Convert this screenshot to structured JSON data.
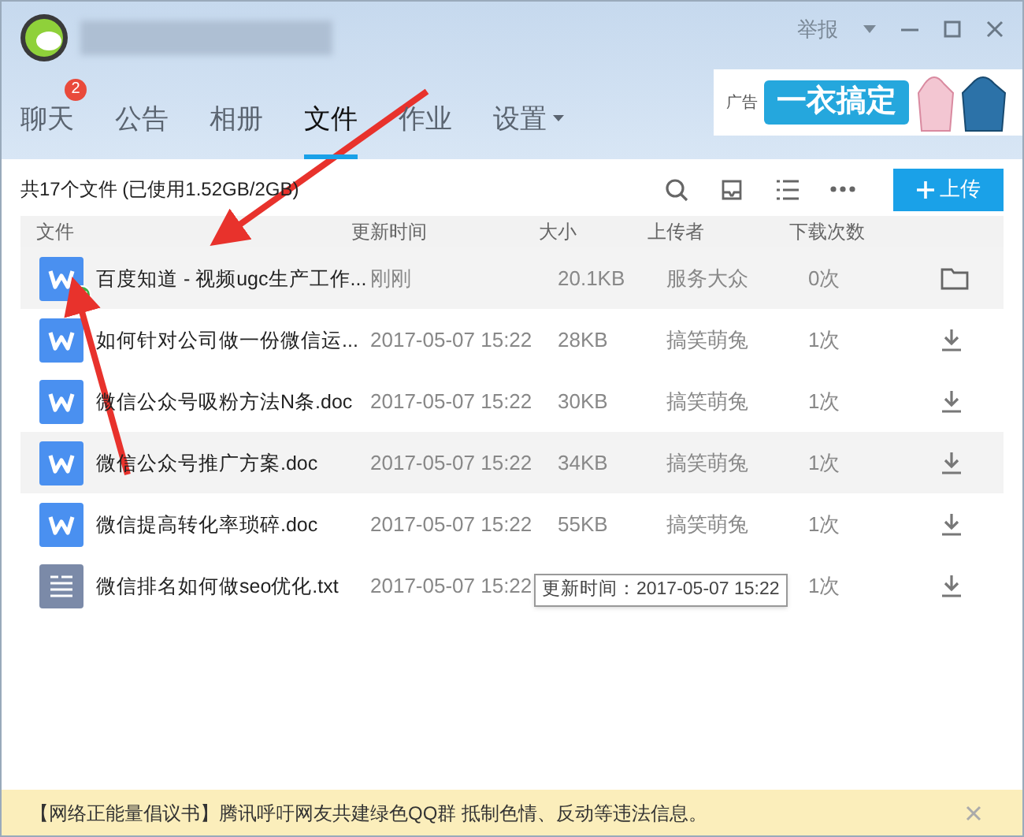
{
  "window": {
    "report": "举报"
  },
  "tabs": [
    {
      "label": "聊天",
      "selected": false,
      "badge": "2",
      "dropdown": false
    },
    {
      "label": "公告",
      "selected": false,
      "dropdown": false
    },
    {
      "label": "相册",
      "selected": false,
      "dropdown": false
    },
    {
      "label": "文件",
      "selected": true,
      "dropdown": false
    },
    {
      "label": "作业",
      "selected": false,
      "dropdown": false
    },
    {
      "label": "设置",
      "selected": false,
      "dropdown": true
    }
  ],
  "ad": {
    "tag": "广告",
    "text": "一衣搞定"
  },
  "toolbar": {
    "summary": "共17个文件 (已使用1.52GB/2GB)",
    "upload": "上传"
  },
  "table": {
    "columns": [
      "文件",
      "更新时间",
      "大小",
      "上传者",
      "下载次数"
    ],
    "rows": [
      {
        "kind": "doc",
        "name": "百度知道 - 视频ugc生产工作...",
        "time": "刚刚",
        "size": "20.1KB",
        "uploader": "服务大众",
        "downloads": "0次",
        "checked": true,
        "selected": true
      },
      {
        "kind": "doc",
        "name": "如何针对公司做一份微信运...",
        "time": "2017-05-07 15:22",
        "size": "28KB",
        "uploader": "搞笑萌兔",
        "downloads": "1次",
        "checked": false,
        "selected": false
      },
      {
        "kind": "doc",
        "name": "微信公众号吸粉方法N条.doc",
        "time": "2017-05-07 15:22",
        "size": "30KB",
        "uploader": "搞笑萌兔",
        "downloads": "1次",
        "checked": false,
        "selected": false
      },
      {
        "kind": "doc",
        "name": "微信公众号推广方案.doc",
        "time": "2017-05-07 15:22",
        "size": "34KB",
        "uploader": "搞笑萌兔",
        "downloads": "1次",
        "checked": false,
        "selected": true
      },
      {
        "kind": "doc",
        "name": "微信提高转化率琐碎.doc",
        "time": "2017-05-07 15:22",
        "size": "55KB",
        "uploader": "搞笑萌兔",
        "downloads": "1次",
        "checked": false,
        "selected": false
      },
      {
        "kind": "txt",
        "name": "微信排名如何做seo优化.txt",
        "time": "2017-05-07 15:22",
        "downloads": "1次",
        "checked": false,
        "selected": false
      }
    ]
  },
  "tooltip": "更新时间：2017-05-07 15:22",
  "notice": "【网络正能量倡议书】腾讯呼吁网友共建绿色QQ群 抵制色情、反动等违法信息。"
}
